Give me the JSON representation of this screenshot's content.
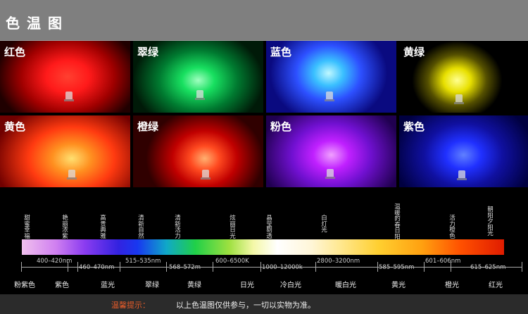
{
  "title": "色温图",
  "tiles": [
    {
      "label": "红色",
      "color": "#ff1a1a"
    },
    {
      "label": "翠绿",
      "color": "#18e060"
    },
    {
      "label": "蓝色",
      "color": "#2d7bff"
    },
    {
      "label": "黄绿",
      "color": "#e8e000"
    },
    {
      "label": "黄色",
      "color": "#ff5a10"
    },
    {
      "label": "橙绿",
      "color": "#ff2a10"
    },
    {
      "label": "粉色",
      "color": "#c020ff"
    },
    {
      "label": "紫色",
      "color": "#2030ff"
    }
  ],
  "moods": [
    "甜蜜幸福",
    "艳丽浓紫",
    "高贵典雅",
    "清新自然",
    "清新活力",
    "炫丽日光",
    "晶莹剔透",
    "白灯光",
    "温暖的春日阳光",
    "活力橙色",
    "朝阳夕阳光"
  ],
  "ranges": [
    "400–420nm",
    "460–470nm",
    "515–535nm",
    "568–572m",
    "600–6500K",
    "1000–12000k",
    "2800–3200nm",
    "585–595nm",
    "601–606nm",
    "615–625nm"
  ],
  "color_names": [
    "粉紫色",
    "紫色",
    "蓝光",
    "翠绿",
    "黄绿",
    "日光",
    "冷白光",
    "暖白光",
    "黄光",
    "橙光",
    "红光"
  ],
  "tip": {
    "label": "温馨提示：",
    "text": "以上色温图仅供参与，一切以实物为准。"
  }
}
